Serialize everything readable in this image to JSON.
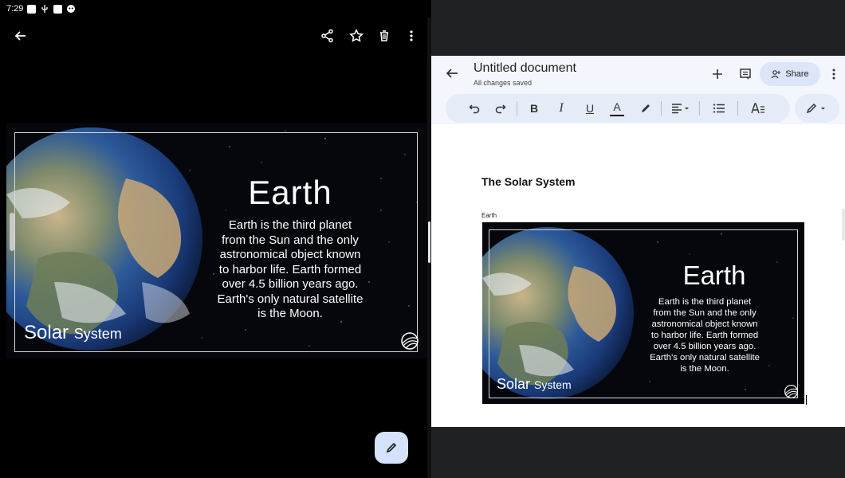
{
  "status_bar": {
    "time": "7:29",
    "icons": [
      "notification-icon",
      "usb-icon",
      "notification-icon",
      "android-icon",
      "wifi-icon"
    ]
  },
  "photo_viewer": {
    "toolbar_icons": [
      "back-arrow-icon",
      "share-icon",
      "star-icon",
      "trash-icon",
      "more-vert-icon"
    ],
    "slide": {
      "title": "Earth",
      "body_lines": [
        "Earth is the third planet",
        "from the Sun and the only",
        "astronomical object known",
        "to harbor life. Earth formed",
        "over 4.5 billion years ago.",
        "Earth's only natural satellite",
        "is the Moon."
      ],
      "brand_main": "Solar",
      "brand_sub": "System"
    },
    "fab_icon": "pencil-icon",
    "accent_color": "#d4e3fb"
  },
  "docs": {
    "title": "Untitled document",
    "save_status": "All changes saved",
    "toolbar_icons": [
      "add-icon",
      "comment-icon"
    ],
    "share_label": "Share",
    "format_buttons": [
      "undo",
      "redo",
      "bold",
      "italic",
      "underline",
      "text-color",
      "highlight",
      "align",
      "list",
      "text-style"
    ],
    "bold_label": "B",
    "italic_label": "I",
    "underline_label": "U",
    "text_color_label": "A",
    "heading": "The Solar System",
    "caption": "Earth",
    "bar_color": "#f3f6fc",
    "share_color": "#dce6f8"
  }
}
